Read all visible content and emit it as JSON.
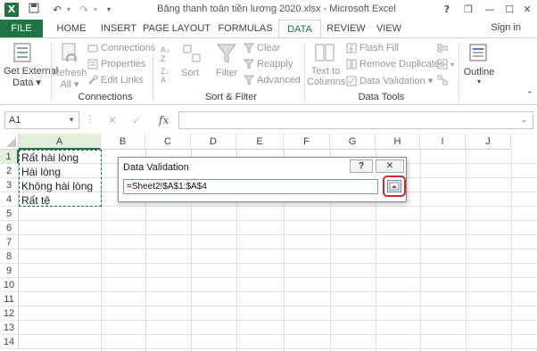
{
  "window": {
    "title": "Bảng thanh toán tiền lương 2020.xlsx - Microsoft Excel",
    "app_icon": "X",
    "buttons": {
      "help": "?",
      "restore": "❐",
      "minimize": "—",
      "maximize": "☐",
      "close": "✕"
    }
  },
  "quick_access": {
    "save": "💾",
    "undo": "↶",
    "redo": "↷",
    "customize": "▾"
  },
  "tabs": [
    "FILE",
    "HOME",
    "INSERT",
    "PAGE LAYOUT",
    "FORMULAS",
    "DATA",
    "REVIEW",
    "VIEW"
  ],
  "active_tab": "DATA",
  "signin": "Sign in",
  "ribbon": {
    "get_external_data": {
      "line1": "Get External",
      "line2": "Data ▾"
    },
    "refresh_all": {
      "line1": "Refresh",
      "line2": "All ▾"
    },
    "connections_group": {
      "items": [
        "Connections",
        "Properties",
        "Edit Links"
      ],
      "label": "Connections"
    },
    "sort_filter_group": {
      "sort": "Sort",
      "filter": "Filter",
      "clear": "Clear",
      "reapply": "Reapply",
      "advanced": "Advanced",
      "label": "Sort & Filter"
    },
    "data_tools_group": {
      "text_to_columns": {
        "line1": "Text to",
        "line2": "Columns"
      },
      "flash_fill": "Flash Fill",
      "remove_duplicates": "Remove Duplicates",
      "data_validation": "Data Validation ▾",
      "label": "Data Tools"
    },
    "outline": {
      "label": "Outline",
      "arrow": "▾"
    }
  },
  "formula_bar": {
    "name_box": "A1",
    "fx": "fx",
    "cancel": "✕",
    "enter": "✓",
    "formula": ""
  },
  "columns": [
    "A",
    "B",
    "C",
    "D",
    "E",
    "F",
    "G",
    "H",
    "I",
    "J"
  ],
  "rows": [
    "1",
    "2",
    "3",
    "4",
    "5",
    "6",
    "7",
    "8",
    "9",
    "10",
    "11",
    "12",
    "13",
    "14"
  ],
  "cells_a": [
    "Rất hài lòng",
    "Hài lòng",
    "Không hài lòng",
    "Rất tệ"
  ],
  "dialog": {
    "title": "Data Validation",
    "help": "?",
    "close": "✕",
    "reference": "=Sheet2!$A$1:$A$4"
  },
  "colors": {
    "excel_green": "#217346",
    "highlight_red": "#d9262c"
  }
}
